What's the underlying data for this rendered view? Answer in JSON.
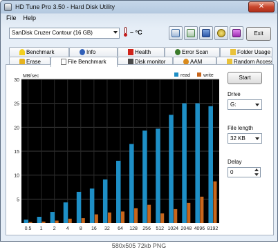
{
  "window": {
    "title": "HD Tune Pro 3.50 - Hard Disk Utility"
  },
  "menu": [
    {
      "label": "File"
    },
    {
      "label": "Help"
    }
  ],
  "toolbar": {
    "drive": "SanDisk Cruzer Contour (16 GB)",
    "temperature": "– °C",
    "exit_label": "Exit"
  },
  "tabs_top": [
    {
      "label": "Benchmark",
      "icon": "benchmark-icon"
    },
    {
      "label": "Info",
      "icon": "info-icon"
    },
    {
      "label": "Health",
      "icon": "health-icon"
    },
    {
      "label": "Error Scan",
      "icon": "error-scan-icon"
    },
    {
      "label": "Folder Usage",
      "icon": "folder-usage-icon"
    }
  ],
  "tabs_bottom": [
    {
      "label": "Erase",
      "icon": "erase-icon"
    },
    {
      "label": "File Benchmark",
      "icon": "file-benchmark-icon",
      "active": true
    },
    {
      "label": "Disk monitor",
      "icon": "disk-monitor-icon"
    },
    {
      "label": "AAM",
      "icon": "aam-icon"
    },
    {
      "label": "Random Access",
      "icon": "random-access-icon"
    }
  ],
  "side": {
    "start_label": "Start",
    "drive_label": "Drive",
    "drive_value": "G:",
    "file_length_label": "File length",
    "file_length_value": "32 KB",
    "delay_label": "Delay",
    "delay_value": "0"
  },
  "footer": {
    "caption": "580x505 72kb PNG"
  },
  "colors": {
    "read": "#1e8fc6",
    "write": "#c8661c",
    "plot_bg": "#000000"
  },
  "chart_data": {
    "type": "bar",
    "ylabel": "MB/sec",
    "ylim": [
      0,
      30
    ],
    "yticks": [
      5,
      10,
      15,
      20,
      25,
      30
    ],
    "categories": [
      "0.5",
      "1",
      "2",
      "4",
      "8",
      "16",
      "32",
      "64",
      "128",
      "256",
      "512",
      "1024",
      "2048",
      "4096",
      "8192"
    ],
    "series": [
      {
        "name": "read",
        "values": [
          0.7,
          1.3,
          2.3,
          4.3,
          6.5,
          7.2,
          9.1,
          13.0,
          16.5,
          19.3,
          19.7,
          22.6,
          25.0,
          25.0,
          24.4
        ]
      },
      {
        "name": "write",
        "values": [
          0.2,
          0.3,
          0.5,
          0.9,
          1.0,
          1.8,
          2.2,
          2.4,
          3.1,
          3.8,
          2.0,
          2.9,
          4.2,
          5.5,
          8.7
        ]
      }
    ]
  }
}
